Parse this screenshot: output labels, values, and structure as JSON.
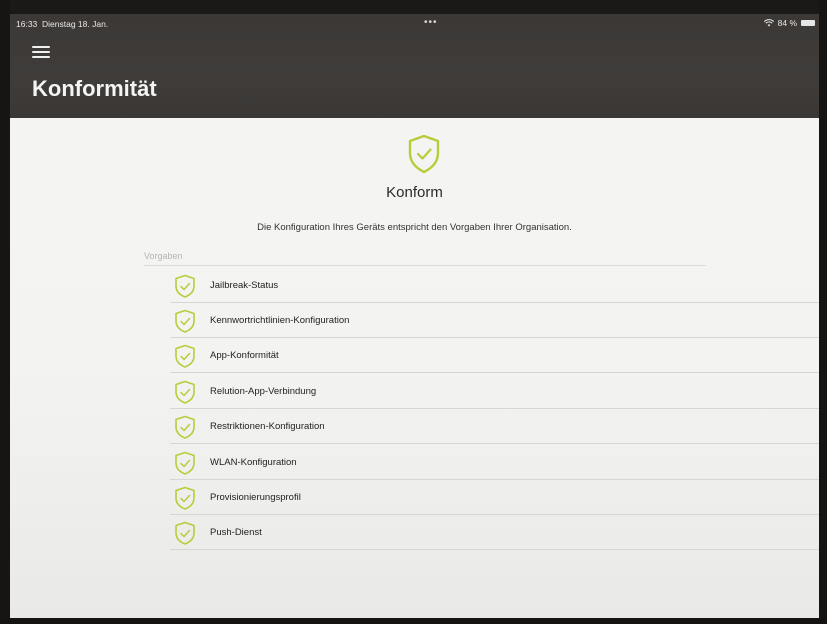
{
  "status_bar": {
    "time": "16:33",
    "date": "Dienstag 18. Jan.",
    "dots": "•••",
    "battery": "84 %"
  },
  "header": {
    "title": "Konformität"
  },
  "summary": {
    "status": "Konform",
    "description": "Die Konfiguration Ihres Geräts entspricht den Vorgaben Ihrer Organisation."
  },
  "section_label": "Vorgaben",
  "requirements": [
    {
      "label": "Jailbreak-Status"
    },
    {
      "label": "Kennwortrichtlinien-Konfiguration"
    },
    {
      "label": "App-Konformität"
    },
    {
      "label": "Relution-App-Verbindung"
    },
    {
      "label": "Restriktionen-Konfiguration"
    },
    {
      "label": "WLAN-Konfiguration"
    },
    {
      "label": "Provisionierungsprofil"
    },
    {
      "label": "Push-Dienst"
    }
  ],
  "colors": {
    "accent_green": "#b9cc3a",
    "header_bg": "#3d3a38"
  },
  "icons": {
    "menu": "hamburger-menu-icon",
    "status": "shield-check-icon",
    "wifi": "wifi-icon",
    "battery": "battery-icon"
  }
}
